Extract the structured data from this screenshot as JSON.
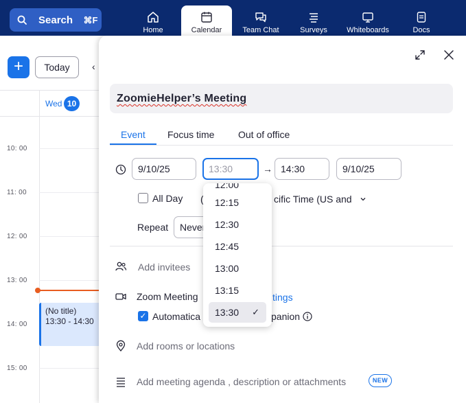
{
  "topbar": {
    "search_label": "Search",
    "search_shortcut": "⌘F",
    "tabs": [
      {
        "label": "Home",
        "icon": "home-icon"
      },
      {
        "label": "Calendar",
        "icon": "calendar-icon",
        "active": true
      },
      {
        "label": "Team Chat",
        "icon": "chat-icon"
      },
      {
        "label": "Surveys",
        "icon": "survey-icon"
      },
      {
        "label": "Whiteboards",
        "icon": "whiteboard-icon"
      },
      {
        "label": "Docs",
        "icon": "doc-icon"
      }
    ]
  },
  "calendar": {
    "add_label": "+",
    "today_label": "Today",
    "prev_label": "‹",
    "day_name": "Wed",
    "day_number": "10",
    "hours": [
      "10: 00",
      "11: 00",
      "12: 00",
      "13: 00",
      "14: 00",
      "15: 00"
    ],
    "event": {
      "title": "(No title)",
      "time": "13:30 - 14:30"
    }
  },
  "panel": {
    "title": "ZoomieHelper’s  Meeting",
    "tabs": [
      "Event",
      "Focus time",
      "Out of office"
    ],
    "active_tab": "Event",
    "start_date": "9/10/25",
    "start_time": "13:30",
    "end_time": "14:30",
    "end_date": "9/10/25",
    "all_day_label": "All Day",
    "timezone_label": "cific Time (US and",
    "timezone_prefix": "(",
    "repeat_label": "Repeat",
    "repeat_value": "Never",
    "add_invitees": "Add invitees",
    "zoom_meeting": "Zoom Meeting",
    "zoom_settings_link": "tings",
    "automatic_label": "Automatica",
    "companion_label": "panion",
    "add_rooms": "Add rooms or locations",
    "agenda_placeholder": "Add meeting agenda , description or attachments",
    "new_badge": "NEW"
  },
  "time_dropdown": {
    "partial_top": "12:00",
    "options": [
      "12:15",
      "12:30",
      "12:45",
      "13:00",
      "13:15",
      "13:30"
    ],
    "selected": "13:30",
    "check": "✓"
  },
  "colors": {
    "topbar": "#0b2a6f",
    "accent": "#1a73e8",
    "now_line": "#e85d20"
  }
}
